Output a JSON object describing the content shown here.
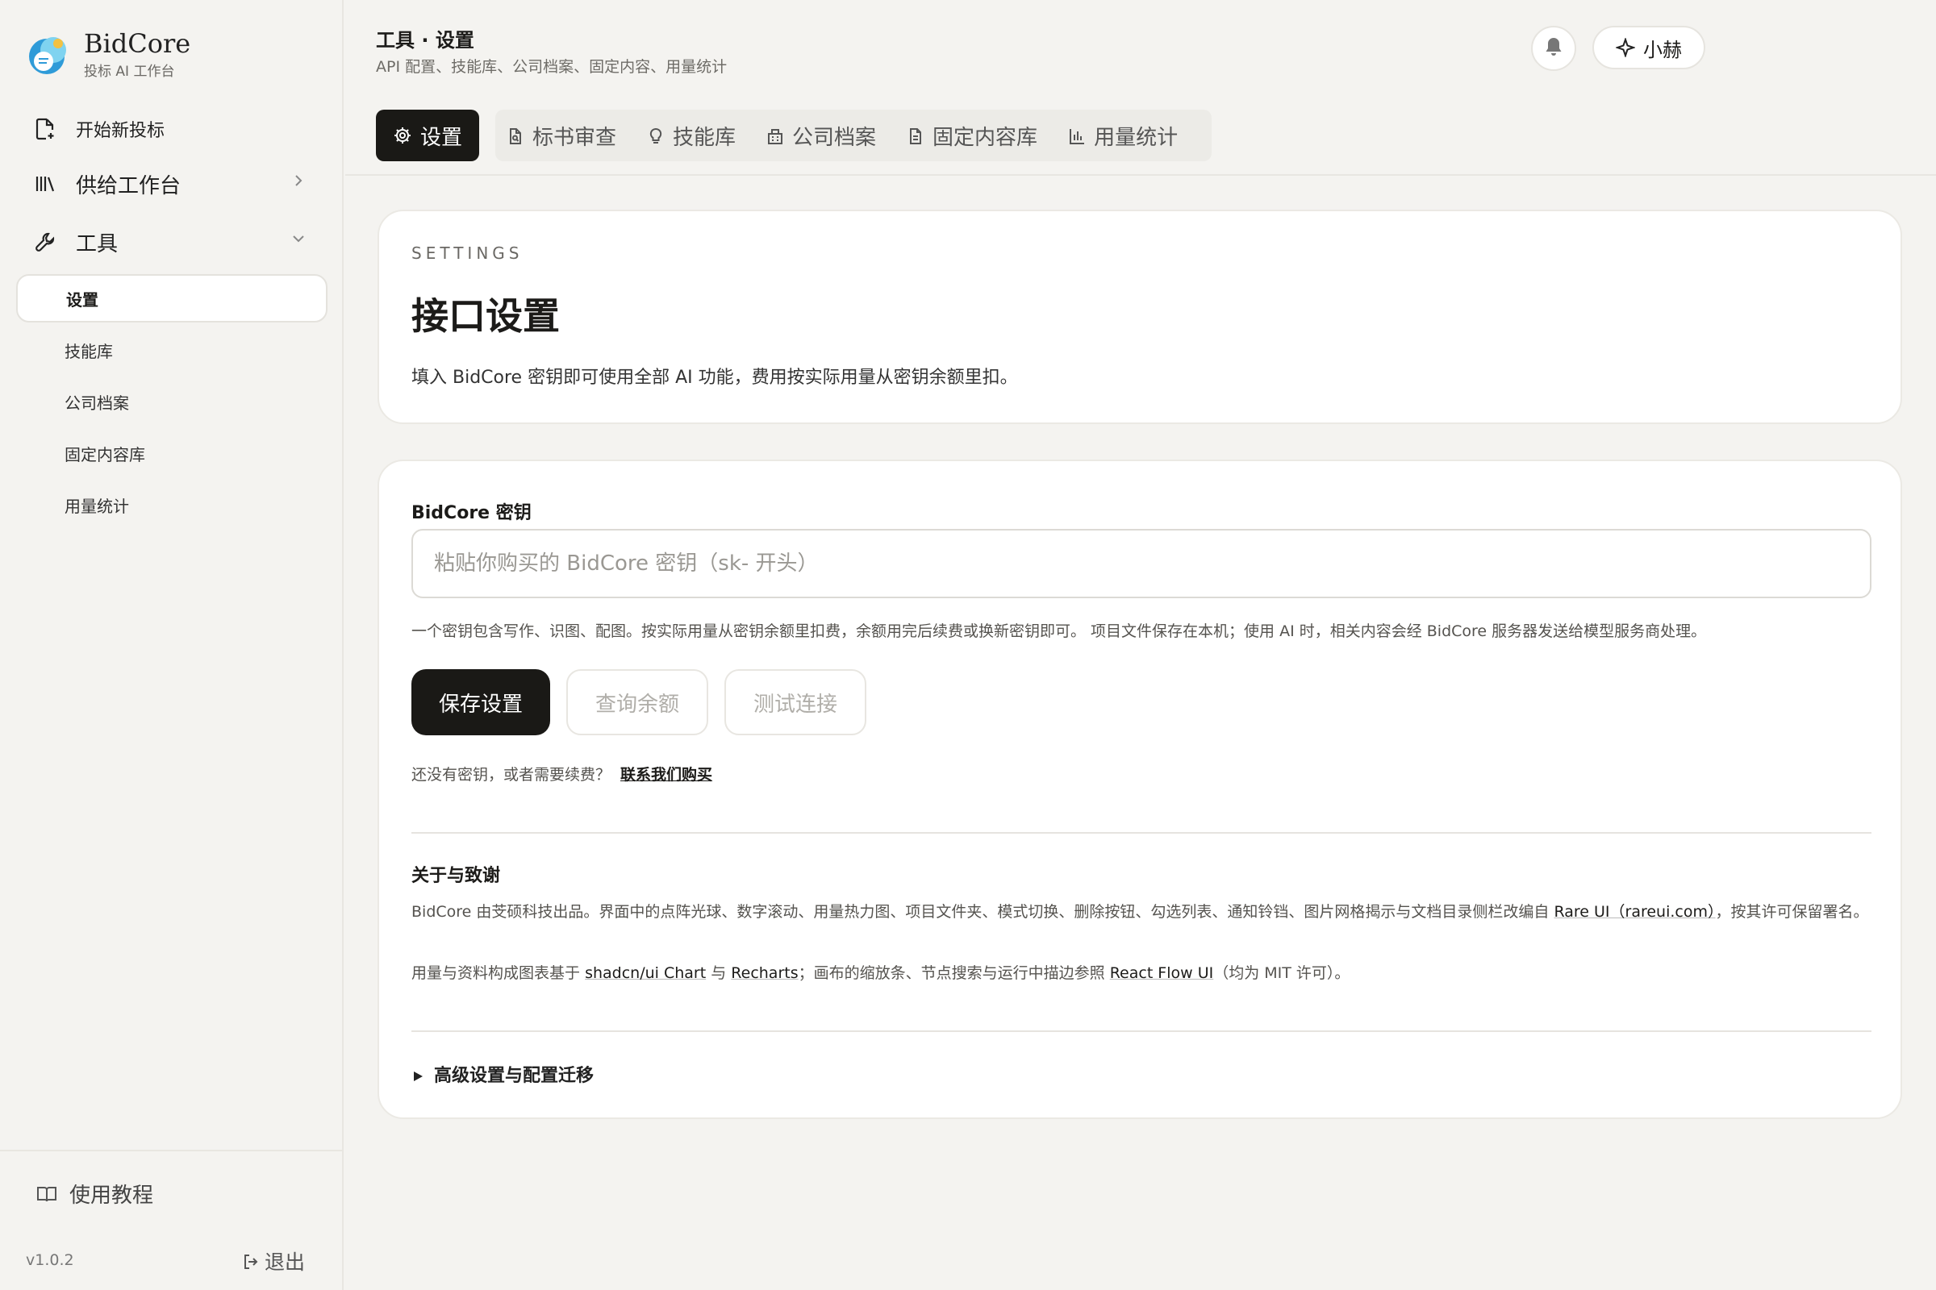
{
  "brand": {
    "name": "BidCore",
    "subtitle": "投标 AI 工作台"
  },
  "sidebar": {
    "new_bid": "开始新投标",
    "supply": "供给工作台",
    "tools": "工具",
    "sub_items": [
      "设置",
      "技能库",
      "公司档案",
      "固定内容库",
      "用量统计"
    ],
    "tutorial": "使用教程",
    "version": "v1.0.2",
    "logout": "退出"
  },
  "header": {
    "title": "工具 · 设置",
    "subtitle": "API 配置、技能库、公司档案、固定内容、用量统计",
    "user": "小赫"
  },
  "tabs": {
    "active": "设置",
    "items": [
      "标书审查",
      "技能库",
      "公司档案",
      "固定内容库",
      "用量统计"
    ]
  },
  "intro": {
    "eyebrow": "SETTINGS",
    "title": "接口设置",
    "description": "填入 BidCore 密钥即可使用全部 AI 功能，费用按实际用量从密钥余额里扣。"
  },
  "form": {
    "key_label": "BidCore 密钥",
    "key_value": "",
    "key_placeholder": "粘贴你购买的 BidCore 密钥（sk- 开头）",
    "hint": "一个密钥包含写作、识图、配图。按实际用量从密钥余额里扣费，余额用完后续费或换新密钥即可。 项目文件保存在本机；使用 AI 时，相关内容会经 BidCore 服务器发送给模型服务商处理。",
    "save": "保存设置",
    "balance": "查询余额",
    "test": "测试连接",
    "buy_prompt": "还没有密钥，或者需要续费？",
    "buy_link": "联系我们购买"
  },
  "about": {
    "title": "关于与致谢",
    "p1_text": "BidCore 由芠硕科技出品。界面中的点阵光球、数字滚动、用量热力图、项目文件夹、模式切换、删除按钮、勾选列表、通知铃铛、图片网格揭示与文档目录侧栏改编自",
    "p1_link": "Rare UI（rareui.com）",
    "p1_tail": "，按其许可保留署名。",
    "p2_text": "用量与资料构成图表基于",
    "p2_link1": "shadcn/ui Chart",
    "p2_and": "与",
    "p2_link2": "Recharts",
    "p2_mid": "；画布的缩放条、节点搜索与运行中描边参照",
    "p2_link3": "React Flow UI",
    "p2_tail": "（均为 MIT 许可）。"
  },
  "advanced": "高级设置与配置迁移",
  "colors": {
    "accent": "#1a1916",
    "background": "#f4f3f0",
    "card": "#ffffff",
    "brand_blue": "#2f9bd8"
  }
}
